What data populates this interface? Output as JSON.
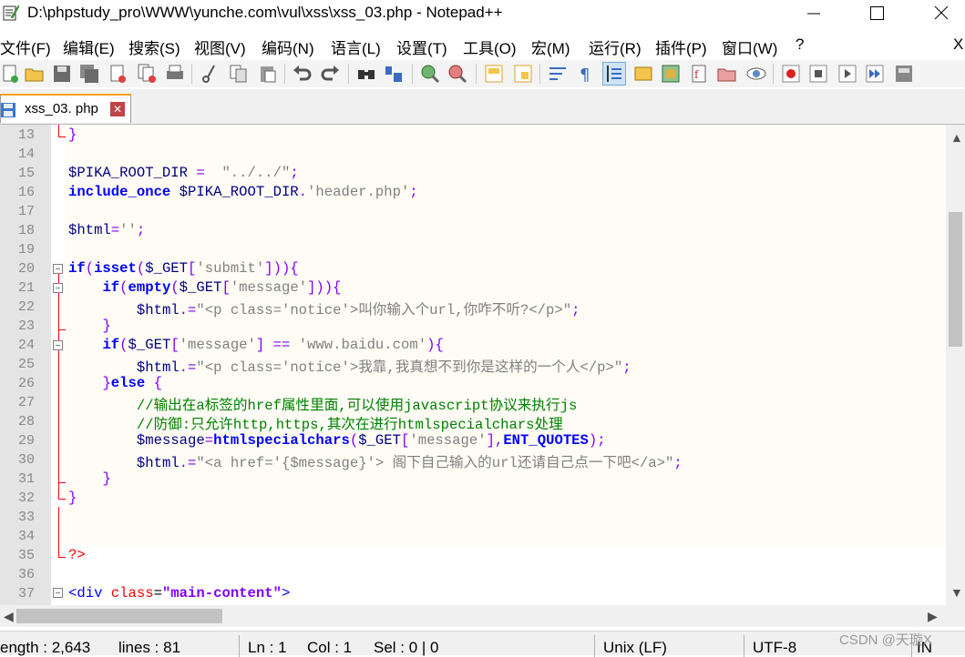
{
  "window": {
    "title": "D:\\phpstudy_pro\\WWW\\yunche.com\\vul\\xss\\xss_03.php - Notepad++"
  },
  "menu": [
    "文件(F)",
    "编辑(E)",
    "搜索(S)",
    "视图(V)",
    "编码(N)",
    "语言(L)",
    "设置(T)",
    "工具(O)",
    "宏(M)",
    "运行(R)",
    "插件(P)",
    "窗口(W)",
    "?",
    "X"
  ],
  "tab": {
    "label": "xss_03. php",
    "close": "✕"
  },
  "editor": {
    "line_numbers": [
      "13",
      "14",
      "15",
      "16",
      "17",
      "18",
      "19",
      "20",
      "21",
      "22",
      "23",
      "24",
      "25",
      "26",
      "27",
      "28",
      "29",
      "30",
      "31",
      "32",
      "33",
      "34",
      "35",
      "36",
      "37"
    ],
    "lines": [
      "}",
      "",
      "$PIKA_ROOT_DIR =  \"../../\";",
      "include_once $PIKA_ROOT_DIR.'header.php';",
      "",
      "$html='';",
      "",
      "if(isset($_GET['submit'])){",
      "    if(empty($_GET['message'])){",
      "        $html.=\"<p class='notice'>叫你输入个url,你咋不听?</p>\";",
      "    }",
      "    if($_GET['message'] == 'www.baidu.com'){",
      "        $html.=\"<p class='notice'>我靠,我真想不到你是这样的一个人</p>\";",
      "    }else {",
      "        //输出在a标签的href属性里面,可以使用javascript协议来执行js",
      "        //防御:只允许http,https,其次在进行htmlspecialchars处理",
      "        $message=htmlspecialchars($_GET['message'],ENT_QUOTES);",
      "        $html.=\"<a href='{$message}'> 阁下自己输入的url还请自己点一下吧</a>\";",
      "    }",
      "}",
      "",
      "",
      "?>",
      "",
      "<div class=\"main-content\">"
    ]
  },
  "status": {
    "length": "ength : 2,643",
    "lines": "lines : 81",
    "ln": "Ln : 1",
    "col": "Col : 1",
    "sel": "Sel : 0 | 0",
    "eol": "Unix (LF)",
    "encoding": "UTF-8",
    "mode": "IN"
  },
  "watermark": "CSDN @天璇X"
}
